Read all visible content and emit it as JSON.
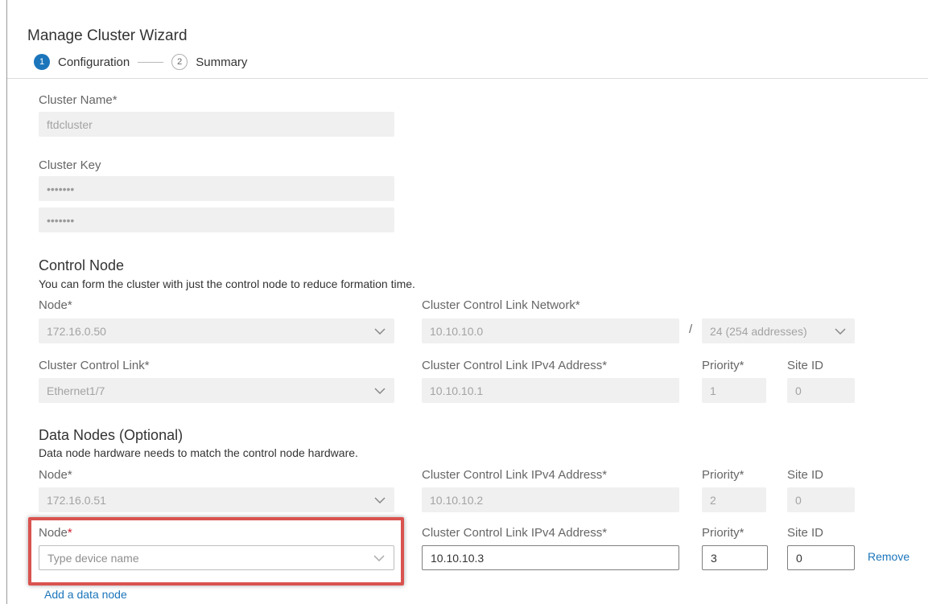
{
  "wizard": {
    "title": "Manage Cluster Wizard",
    "steps": [
      {
        "number": "1",
        "label": "Configuration",
        "state": "active"
      },
      {
        "number": "2",
        "label": "Summary",
        "state": "inactive"
      }
    ]
  },
  "cluster": {
    "name_label": "Cluster Name",
    "name_value": "ftdcluster",
    "key_label": "Cluster Key",
    "key_value": "•••••••",
    "key_confirm_value": "•••••••"
  },
  "control_node": {
    "heading": "Control Node",
    "hint": "You can form the cluster with just the control node to reduce formation time.",
    "node_label": "Node",
    "node_value": "172.16.0.50",
    "ccl_network_label": "Cluster Control Link Network",
    "ccl_network_value": "10.10.10.0",
    "ccl_network_slash": "/",
    "ccl_network_mask": "24 (254 addresses)",
    "ccl_label": "Cluster Control Link",
    "ccl_value": "Ethernet1/7",
    "ccl_ipv4_label": "Cluster Control Link IPv4 Address",
    "ccl_ipv4_value": "10.10.10.1",
    "priority_label": "Priority",
    "priority_value": "1",
    "site_id_label": "Site ID",
    "site_id_value": "0"
  },
  "data_nodes": {
    "heading": "Data Nodes (Optional)",
    "hint": "Data node hardware needs to match the control node hardware.",
    "rows": [
      {
        "node_label": "Node",
        "node_value": "172.16.0.51",
        "ccl_ipv4_label": "Cluster Control Link IPv4 Address",
        "ccl_ipv4_value": "10.10.10.2",
        "priority_label": "Priority",
        "priority_value": "2",
        "site_id_label": "Site ID",
        "site_id_value": "0"
      },
      {
        "node_label": "Node",
        "node_placeholder": "Type device name",
        "ccl_ipv4_label": "Cluster Control Link IPv4 Address",
        "ccl_ipv4_value": "10.10.10.3",
        "priority_label": "Priority",
        "priority_value": "3",
        "site_id_label": "Site ID",
        "site_id_value": "0",
        "remove_label": "Remove"
      }
    ],
    "add_label": "Add a data node"
  },
  "required_marker": "*",
  "colors": {
    "accent": "#1b75bb",
    "highlight": "#d9534f",
    "required": "#cf2030"
  }
}
